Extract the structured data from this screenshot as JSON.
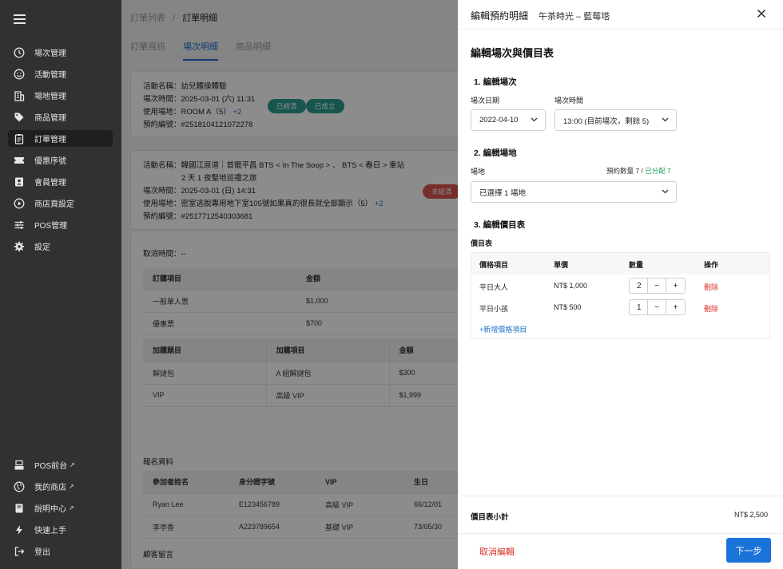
{
  "sidebar": {
    "items": [
      {
        "label": "場次管理",
        "icon": "clock-icon"
      },
      {
        "label": "活動管理",
        "icon": "smile-icon"
      },
      {
        "label": "場地管理",
        "icon": "building-icon"
      },
      {
        "label": "商品管理",
        "icon": "tag-icon"
      },
      {
        "label": "訂單管理",
        "icon": "clipboard-icon",
        "active": true
      },
      {
        "label": "優惠序號",
        "icon": "ticket-icon"
      },
      {
        "label": "會員管理",
        "icon": "member-icon"
      },
      {
        "label": "商店頁設定",
        "icon": "play-icon"
      },
      {
        "label": "POS管理",
        "icon": "sliders-icon"
      },
      {
        "label": "設定",
        "icon": "gear-icon"
      }
    ],
    "bottom": [
      {
        "label": "POS前台",
        "icon": "register-icon"
      },
      {
        "label": "我的商店",
        "icon": "globe-icon"
      },
      {
        "label": "說明中心",
        "icon": "book-icon"
      },
      {
        "label": "快速上手",
        "icon": "bolt-icon"
      },
      {
        "label": "登出",
        "icon": "logout-icon"
      }
    ],
    "external_mark": "↗"
  },
  "main": {
    "breadcrumb": {
      "parent": "訂單列表",
      "sep": "/",
      "current": "訂單明細"
    },
    "tabs": [
      "訂單資訊",
      "場次明細",
      "商品明細"
    ],
    "card1": {
      "lines": [
        "活動名稱：幼兒體操體驗",
        "場次時間：2025-03-01 (六) 11:31",
        "使用場地：ROOM A（5）",
        "預約編號：#2518104121072278"
      ],
      "more": "+2",
      "badges": [
        "已結清",
        "已成立"
      ]
    },
    "card2": {
      "lines": [
        "活動名稱：韓國江原道｜首爾平昌 BTS < In The Soop > 、 BTS < 春日 > 車站",
        "2 天 1 夜聖地巡禮之旅",
        "場次時間：2025-03-01 (日) 14:31",
        "使用場地：密室逃脫專用地下室105號如果真的很長就全部顯示（5）",
        "預約編號：#2517712540303681"
      ],
      "more": "+2",
      "badge": "未結清"
    },
    "cancel_time": "取消時間：--",
    "order_table": {
      "headers": [
        "訂購項目",
        "金額"
      ],
      "rows": [
        [
          "一般單人票",
          "$1,000"
        ],
        [
          "優惠票",
          "$700"
        ]
      ]
    },
    "addon_table": {
      "headers": [
        "加購題目",
        "加購項目",
        "金額"
      ],
      "rows": [
        [
          "解謎包",
          "A 組解謎包",
          "$300"
        ],
        [
          "VIP",
          "高級 VIP",
          "$1,999"
        ]
      ]
    },
    "signup_title": "報名資料",
    "signup_table": {
      "headers": [
        "參加者姓名",
        "身分證字號",
        "VIP",
        "生日"
      ],
      "rows": [
        [
          "Ryan Lee",
          "E123456789",
          "高級 VIP",
          "66/12/01"
        ],
        [
          "李亭香",
          "A223789654",
          "基礎 VIP",
          "73/05/30"
        ]
      ]
    },
    "comment_title": "顧客留言"
  },
  "drawer": {
    "title": "編輯預約明細",
    "subtitle": "午茶時光 – 藍莓塔",
    "heading": "編輯場次與價目表",
    "step1": "1. 編輯場次",
    "date_label": "場次日期",
    "date_value": "2022-04-10",
    "time_label": "場次時間",
    "time_value": "13:00 (目前場次，剩餘 5)",
    "step2": "2. 編輯場地",
    "venue_label": "場地",
    "venue_count_prefix": "預約數量 7 /",
    "venue_count_allocated": "已分配 7",
    "venue_value": "已選擇 1 場地",
    "step3": "3. 編輯價目表",
    "price_table_label": "價目表",
    "price_headers": [
      "價格項目",
      "單價",
      "數量",
      "操作"
    ],
    "price_rows": [
      {
        "item": "平日大人",
        "price": "NT$ 1,000",
        "qty": "2",
        "action": "刪除"
      },
      {
        "item": "平日小孩",
        "price": "NT$ 500",
        "qty": "1",
        "action": "刪除"
      }
    ],
    "add_price": "+新增價格項目",
    "subtotal_label": "價目表小計",
    "subtotal_value": "NT$ 2,500",
    "cancel": "取消編輯",
    "next": "下一步",
    "colors": {
      "primary": "#1a73d9",
      "danger": "#d93025",
      "success": "#1f9d55"
    }
  }
}
